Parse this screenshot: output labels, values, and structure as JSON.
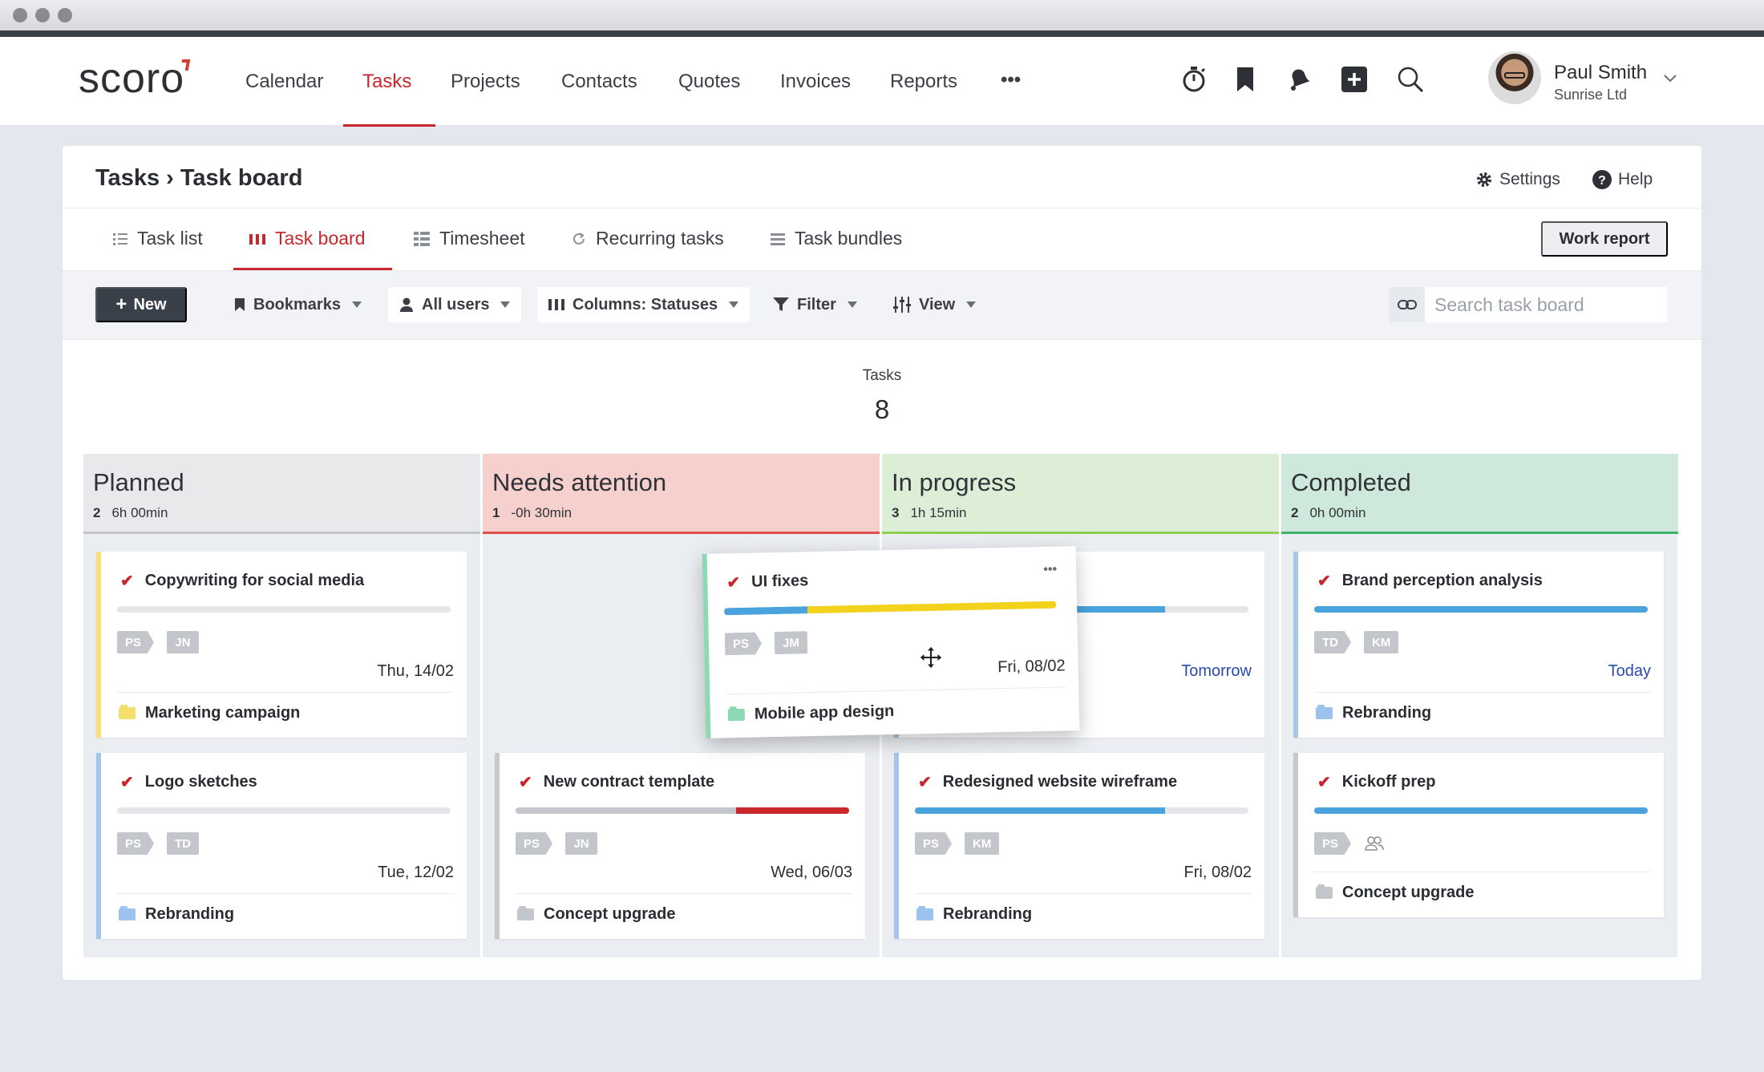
{
  "header": {
    "logo": "scoro",
    "nav": [
      "Calendar",
      "Tasks",
      "Projects",
      "Contacts",
      "Quotes",
      "Invoices",
      "Reports",
      "•••"
    ],
    "active_nav": "Tasks",
    "user": {
      "name": "Paul Smith",
      "company": "Sunrise Ltd"
    }
  },
  "page": {
    "breadcrumb": "Tasks › Task board",
    "settings_label": "Settings",
    "help_label": "Help",
    "tabs": [
      "Task list",
      "Task board",
      "Timesheet",
      "Recurring tasks",
      "Task bundles"
    ],
    "active_tab": "Task board",
    "work_report_label": "Work report"
  },
  "toolbar": {
    "new_label": "New",
    "bookmarks_label": "Bookmarks",
    "users_label": "All users",
    "columns_label": "Columns: Statuses",
    "filter_label": "Filter",
    "view_label": "View",
    "search_placeholder": "Search task board"
  },
  "summary": {
    "label": "Tasks",
    "count": "8"
  },
  "columns": [
    {
      "title": "Planned",
      "count": "2",
      "time": "6h 00min",
      "color": "#c2c4c8",
      "bg": "#e8e9eb"
    },
    {
      "title": "Needs attention",
      "count": "1",
      "time": "-0h 30min",
      "color": "#e0504a",
      "bg": "#f6d0cc"
    },
    {
      "title": "In progress",
      "count": "3",
      "time": "1h 15min",
      "color": "#8fcf4f",
      "bg": "#dcefd6"
    },
    {
      "title": "Completed",
      "count": "2",
      "time": "0h 00min",
      "color": "#3cb26c",
      "bg": "#cfe8dc"
    }
  ],
  "cards": {
    "c1": {
      "title": "Copywriting for social media",
      "tags": [
        "PS",
        "JN"
      ],
      "date": "Thu, 14/02",
      "project": "Marketing campaign"
    },
    "c2": {
      "title": "Logo sketches",
      "tags": [
        "PS",
        "TD"
      ],
      "date": "Tue, 12/02",
      "project": "Rebranding"
    },
    "c3": {
      "title": "New contract template",
      "tags": [
        "PS",
        "JN"
      ],
      "date": "Wed, 06/03",
      "project": "Concept upgrade"
    },
    "c4": {
      "date": "Tomorrow"
    },
    "c5": {
      "title": "Redesigned website wireframe",
      "tags": [
        "PS",
        "KM"
      ],
      "date": "Fri, 08/02",
      "project": "Rebranding"
    },
    "c6": {
      "title": "Brand perception analysis",
      "tags": [
        "TD",
        "KM"
      ],
      "date": "Today",
      "project": "Rebranding"
    },
    "c7": {
      "title": "Kickoff prep",
      "tags": [
        "PS"
      ],
      "project": "Concept upgrade"
    },
    "drag": {
      "title": "UI fixes",
      "tags": [
        "PS",
        "JM"
      ],
      "date": "Fri, 08/02",
      "project": "Mobile app design",
      "more": "•••"
    }
  }
}
